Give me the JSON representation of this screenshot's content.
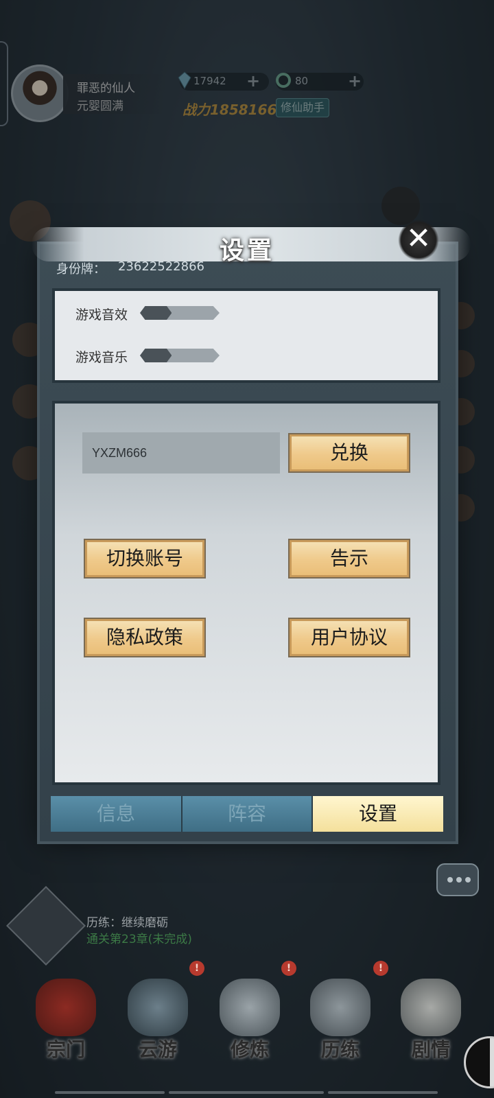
{
  "player": {
    "name": "罪恶的仙人",
    "realm": "元婴圆满",
    "crystals": "17942",
    "jade": "80",
    "power_text": "战力1858166",
    "helper_label": "修仙助手"
  },
  "modal": {
    "title": "设置",
    "id_label": "身份牌：",
    "id_value": "23622522866",
    "close_icon": "✕",
    "sound_effects_label": "游戏音效",
    "sound_effects_level": 0.4,
    "music_label": "游戏音乐",
    "music_level": 0.4,
    "redeem_code_value": "YXZM666",
    "redeem_button": "兑换",
    "switch_account_button": "切换账号",
    "notice_button": "告示",
    "privacy_button": "隐私政策",
    "agreement_button": "用户协议",
    "tabs": [
      {
        "label": "信息",
        "active": false
      },
      {
        "label": "阵容",
        "active": false
      },
      {
        "label": "设置",
        "active": true
      }
    ]
  },
  "quest": {
    "title": "历练：继续磨砺",
    "status": "通关第23章(未完成)"
  },
  "bottom_nav": [
    {
      "label": "宗门",
      "icon": "sect-hall-icon",
      "badge": ""
    },
    {
      "label": "云游",
      "icon": "mountain-travel-icon",
      "badge": "!"
    },
    {
      "label": "修炼",
      "icon": "cultivation-icon",
      "badge": "!"
    },
    {
      "label": "历练",
      "icon": "training-icon",
      "badge": "!"
    },
    {
      "label": "剧情",
      "icon": "scroll-story-icon",
      "badge": ""
    }
  ],
  "colors": {
    "accent_gold": "#efc98a",
    "tab_active": "#f4e09c",
    "tab_inactive": "#3f6e85",
    "quest_status": "#3c7a46",
    "badge_red": "#b73a2e"
  }
}
